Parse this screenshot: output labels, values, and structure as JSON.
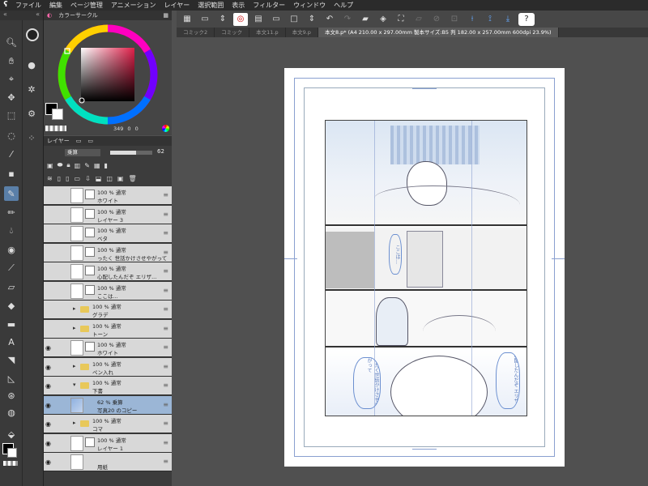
{
  "menu": {
    "app_icon": "ʕ",
    "items": [
      "ファイル",
      "編集",
      "ページ管理",
      "アニメーション",
      "レイヤー",
      "選択範囲",
      "表示",
      "フィルター",
      "ウィンドウ",
      "ヘルプ"
    ]
  },
  "color_panel": {
    "tab_label": "カラーサークル",
    "hsv": {
      "h": "349",
      "s": "0",
      "v": "0"
    }
  },
  "layer_panel": {
    "tab_label": "レイヤー",
    "blend_mode": "乗算",
    "opacity": "62",
    "layers": [
      {
        "line1": "100 % 通常",
        "line2": "ホワイト",
        "type": "raster",
        "eye": false
      },
      {
        "line1": "100 % 通常",
        "line2": "レイヤー 3",
        "type": "raster",
        "eye": false
      },
      {
        "line1": "100 % 通常",
        "line2": "ベタ",
        "type": "raster",
        "eye": false
      },
      {
        "line1": "100 % 通常",
        "line2": "ったく 世話かけさせやがって",
        "type": "text",
        "eye": false
      },
      {
        "line1": "100 % 通常",
        "line2": "心配したんだぞ エリザ...",
        "type": "text",
        "eye": false
      },
      {
        "line1": "100 % 通常",
        "line2": "ここは...",
        "type": "text",
        "eye": false
      },
      {
        "line1": "100 % 通常",
        "line2": "グラデ",
        "type": "folder",
        "eye": false
      },
      {
        "line1": "100 % 通常",
        "line2": "トーン",
        "type": "folder",
        "eye": false
      },
      {
        "line1": "100 % 通常",
        "line2": "ホワイト",
        "type": "raster",
        "eye": true
      },
      {
        "line1": "100 % 通常",
        "line2": "ペン入れ",
        "type": "folder",
        "eye": true
      },
      {
        "line1": "100 % 通常",
        "line2": "下書",
        "type": "folder-open",
        "eye": true
      },
      {
        "line1": "62 % 乗算",
        "line2": "写真20 のコピー",
        "type": "photo",
        "eye": true,
        "selected": true
      },
      {
        "line1": "100 % 通常",
        "line2": "コマ",
        "type": "folder",
        "eye": true
      },
      {
        "line1": "100 % 通常",
        "line2": "レイヤー 1",
        "type": "raster",
        "eye": true
      },
      {
        "line1": "",
        "line2": "用紙",
        "type": "paper",
        "eye": true
      }
    ]
  },
  "tabs": [
    {
      "label": "コミック2",
      "active": false
    },
    {
      "label": "コミック",
      "active": false
    },
    {
      "label": "本文11.p",
      "active": false
    },
    {
      "label": "本文9.p",
      "active": false
    },
    {
      "label": "本文8.p* (A4 210.00 x 297.00mm 製本サイズ:B5 判 182.00 x 257.00mm 600dpi 23.9%)",
      "active": true
    }
  ],
  "page_text": {
    "bubble1": "ここは…",
    "bubble2": "心配したんだぞ エリザ",
    "bubble3": "ったく世話かけさせやがって"
  }
}
